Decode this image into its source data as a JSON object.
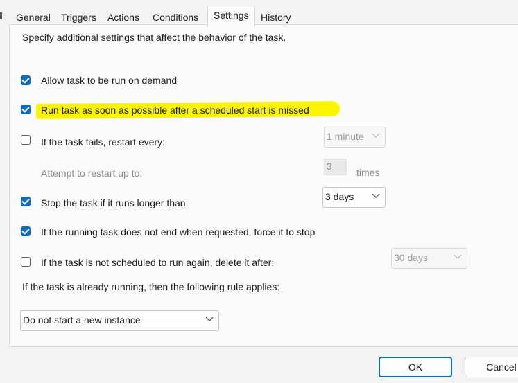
{
  "tabs": [
    {
      "label": "General"
    },
    {
      "label": "Triggers"
    },
    {
      "label": "Actions"
    },
    {
      "label": "Conditions"
    },
    {
      "label": "Settings"
    },
    {
      "label": "History"
    }
  ],
  "active_tab": "Settings",
  "description": "Specify additional settings that affect the behavior of the task.",
  "settings": {
    "allow_on_demand": {
      "label": "Allow task to be run on demand",
      "checked": true
    },
    "run_missed": {
      "label": "Run task as soon as possible after a scheduled start is missed",
      "checked": true,
      "highlight_color": "#fbf400"
    },
    "restart_on_fail": {
      "label": "If the task fails, restart every:",
      "checked": false,
      "interval": "1 minute"
    },
    "restart_attempts": {
      "label": "Attempt to restart up to:",
      "value": "3",
      "unit": "times"
    },
    "stop_if_longer": {
      "label": "Stop the task if it runs longer than:",
      "checked": true,
      "duration": "3 days"
    },
    "force_stop": {
      "label": "If the running task does not end when requested, force it to stop",
      "checked": true
    },
    "delete_if_not_scheduled": {
      "label": "If the task is not scheduled to run again, delete it after:",
      "checked": false,
      "duration": "30 days"
    },
    "running_rule": {
      "label": "If the task is already running, then the following rule applies:",
      "value": "Do not start a new instance"
    }
  },
  "buttons": {
    "ok": "OK",
    "cancel": "Cancel"
  },
  "colors": {
    "accent": "#0f6cbd",
    "highlight": "#fbf400"
  }
}
